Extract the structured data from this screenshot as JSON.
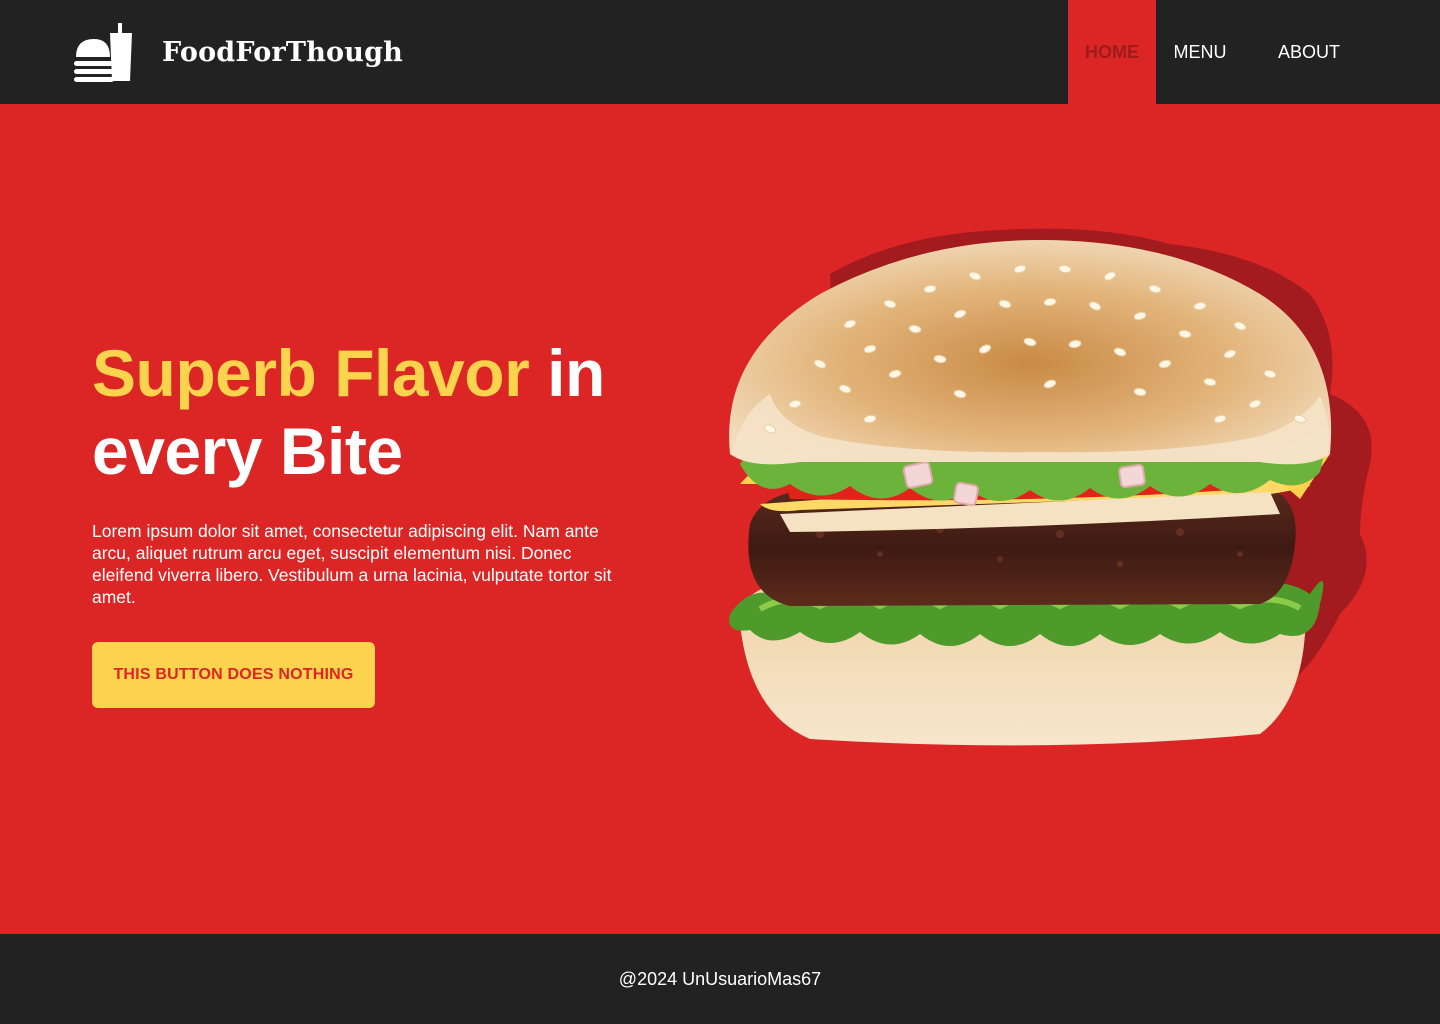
{
  "header": {
    "brand_name": "FoodForThough",
    "logo_icon": "burger-drink-icon",
    "nav": [
      {
        "label": "HOME",
        "active": true
      },
      {
        "label": "MENU",
        "active": false
      },
      {
        "label": "ABOUT",
        "active": false
      }
    ]
  },
  "hero": {
    "title_accent": "Superb Flavor",
    "title_rest": " in every Bite",
    "description": " Lorem ipsum dolor sit amet, consectetur adipiscing elit. Nam ante arcu,  aliquet rutrum arcu eget, suscipit elementum nisi. Donec eleifend  viverra libero. Vestibulum a urna lacinia, vulputate tortor sit amet.",
    "button_label": "THIS BUTTON DOES NOTHING",
    "image": "burger-image"
  },
  "footer": {
    "text": "@2024 UnUsuarioMas67"
  },
  "colors": {
    "nav_bg": "#222222",
    "primary_red": "#DC2626",
    "accent_yellow": "#FCD34D",
    "shadow_red": "#A31B1E"
  }
}
